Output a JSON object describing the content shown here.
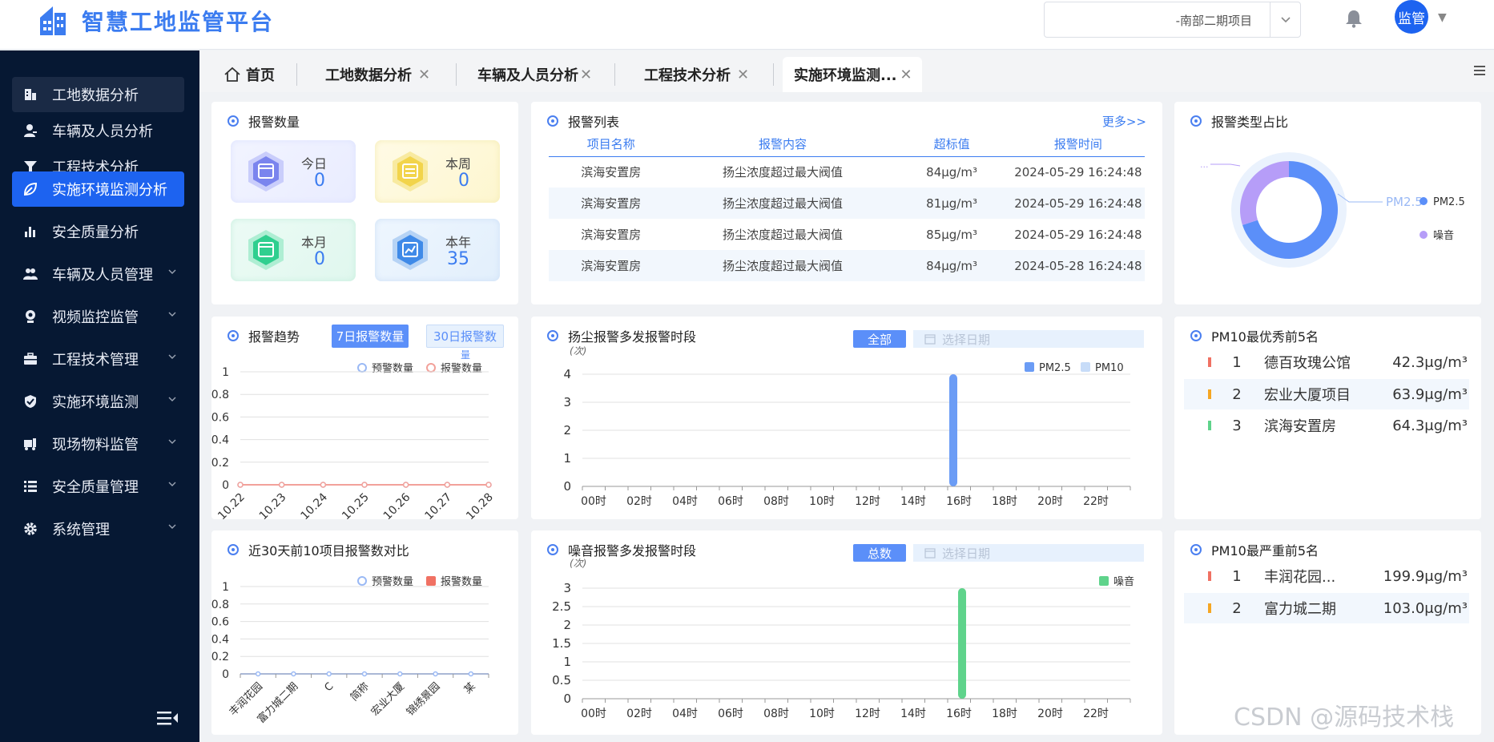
{
  "header": {
    "title": "智慧工地监管平台",
    "project_selected": "-南部二期项目",
    "user_name": "监管"
  },
  "sidebar": {
    "items": [
      {
        "label": "工地数据分析",
        "icon": "building-icon"
      },
      {
        "label": "车辆及人员分析",
        "icon": "person-icon"
      },
      {
        "label": "工程技术分析",
        "icon": "funnel-icon"
      },
      {
        "label": "实施环境监测分析",
        "icon": "leaf-icon"
      },
      {
        "label": "安全质量分析",
        "icon": "bar-chart-icon"
      },
      {
        "label": "车辆及人员管理",
        "icon": "group-icon"
      },
      {
        "label": "视频监控监管",
        "icon": "camera-icon"
      },
      {
        "label": "工程技术管理",
        "icon": "toolbox-icon"
      },
      {
        "label": "实施环境监测",
        "icon": "shield-icon"
      },
      {
        "label": "现场物料监管",
        "icon": "cart-icon"
      },
      {
        "label": "安全质量管理",
        "icon": "list-icon"
      },
      {
        "label": "系统管理",
        "icon": "gear-icon"
      }
    ]
  },
  "tabs": [
    {
      "label": "首页"
    },
    {
      "label": "工地数据分析"
    },
    {
      "label": "车辆及人员分析"
    },
    {
      "label": "工程技术分析"
    },
    {
      "label": "实施环境监测..."
    }
  ],
  "alarm_count": {
    "title": "报警数量",
    "today_label": "今日",
    "today": "0",
    "week_label": "本周",
    "week": "0",
    "month_label": "本月",
    "month": "0",
    "year_label": "本年",
    "year": "35"
  },
  "alarm_list": {
    "title": "报警列表",
    "more": "更多>>",
    "headers": [
      "项目名称",
      "报警内容",
      "超标值",
      "报警时间"
    ],
    "rows": [
      [
        "滨海安置房",
        "扬尘浓度超过最大阀值",
        "84μg/m³",
        "2024-05-29 16:24:48"
      ],
      [
        "滨海安置房",
        "扬尘浓度超过最大阀值",
        "81μg/m³",
        "2024-05-29 16:24:48"
      ],
      [
        "滨海安置房",
        "扬尘浓度超过最大阀值",
        "85μg/m³",
        "2024-05-29 16:24:48"
      ],
      [
        "滨海安置房",
        "扬尘浓度超过最大阀值",
        "84μg/m³",
        "2024-05-28 16:24:48"
      ]
    ]
  },
  "alarm_type": {
    "title": "报警类型占比",
    "legend": [
      "PM2.5",
      "噪音"
    ],
    "callout_label": "PM2.5",
    "callout_left": "..."
  },
  "alarm_trend": {
    "title": "报警趋势",
    "btn7": "7日报警数量",
    "btn30": "30日报警数",
    "btn30_cut": "量"
  },
  "dust_period": {
    "title": "扬尘报警多发报警时段",
    "btn_all": "全部",
    "date_placeholder": "选择日期"
  },
  "noise_period": {
    "title": "噪音报警多发报警时段",
    "btn_total": "总数",
    "date_placeholder": "选择日期"
  },
  "compare30": {
    "title": "近30天前10项目报警数对比"
  },
  "pm10_best": {
    "title": "PM10最优秀前5名",
    "rows": [
      {
        "rank": "1",
        "name": "德百玫瑰公馆",
        "value": "42.3μg/m³",
        "color": "#f07163"
      },
      {
        "rank": "2",
        "name": "宏业大厦项目",
        "value": "63.9μg/m³",
        "color": "#f5a623"
      },
      {
        "rank": "3",
        "name": "滨海安置房",
        "value": "64.3μg/m³",
        "color": "#5fd38b"
      }
    ]
  },
  "pm10_worst": {
    "title": "PM10最严重前5名",
    "rows": [
      {
        "rank": "1",
        "name": "丰润花园...",
        "value": "199.9μg/m³",
        "color": "#f07163"
      },
      {
        "rank": "2",
        "name": "富力城二期",
        "value": "103.0μg/m³",
        "color": "#f5a623"
      }
    ]
  },
  "watermark": "CSDN @源码技术栈",
  "chart_data": [
    {
      "type": "line",
      "x": [
        "10.22",
        "10.23",
        "10.24",
        "10.25",
        "10.26",
        "10.27",
        "10.28"
      ],
      "series": [
        {
          "name": "预警数量",
          "values": [
            0,
            0,
            0,
            0,
            0,
            0,
            0
          ],
          "color": "#9ab9f5"
        },
        {
          "name": "报警数量",
          "values": [
            0,
            0,
            0,
            0,
            0,
            0,
            0
          ],
          "color": "#f2a19a"
        }
      ],
      "yticks": [
        "1",
        "0.8",
        "0.6",
        "0.4",
        "0.2",
        "0"
      ],
      "ylim": [
        0,
        1
      ]
    },
    {
      "type": "bar",
      "categories": [
        "00时",
        "02时",
        "04时",
        "06时",
        "08时",
        "10时",
        "12时",
        "14时",
        "16时",
        "18时",
        "20时",
        "22时"
      ],
      "unit": "(次)",
      "series": [
        {
          "name": "PM2.5",
          "color": "#6b9cf5",
          "values": [
            0,
            0,
            0,
            0,
            0,
            0,
            0,
            0,
            4,
            0,
            0,
            0
          ]
        },
        {
          "name": "PM10",
          "color": "#c7dcf8",
          "values": [
            0,
            0,
            0,
            0,
            0,
            0,
            0,
            0,
            0,
            0,
            0,
            0
          ]
        }
      ],
      "yticks": [
        "4",
        "3",
        "2",
        "1",
        "0"
      ],
      "ylim": [
        0,
        4
      ]
    },
    {
      "type": "bar",
      "categories": [
        "00时",
        "02时",
        "04时",
        "06时",
        "08时",
        "10时",
        "12时",
        "14时",
        "16时",
        "18时",
        "20时",
        "22时"
      ],
      "unit": "(次)",
      "series": [
        {
          "name": "噪音",
          "color": "#5fd38b",
          "values": [
            0,
            0,
            0,
            0,
            0,
            0,
            0,
            0,
            3,
            0,
            0,
            0
          ]
        }
      ],
      "yticks": [
        "3",
        "2.5",
        "2",
        "1.5",
        "1",
        "0.5",
        "0"
      ],
      "ylim": [
        0,
        3
      ]
    },
    {
      "type": "bar",
      "categories": [
        "丰润花园",
        "富力城二期",
        "C",
        "简称",
        "宏业大厦",
        "锦绣景园",
        "某"
      ],
      "series": [
        {
          "name": "预警数量",
          "values": [
            0,
            0,
            0,
            0,
            0,
            0,
            0
          ],
          "color": "#9ab9f5"
        },
        {
          "name": "报警数量",
          "values": [
            0,
            0,
            0,
            0,
            0,
            0,
            0
          ],
          "color": "#f07163"
        }
      ],
      "yticks": [
        "1",
        "0.8",
        "0.6",
        "0.4",
        "0.2",
        "0"
      ],
      "ylim": [
        0,
        1
      ]
    },
    {
      "type": "pie",
      "categories": [
        "PM2.5",
        "噪音"
      ],
      "values": [
        35,
        15
      ],
      "colors": [
        "#5b8ff9",
        "#b69df8"
      ]
    }
  ]
}
